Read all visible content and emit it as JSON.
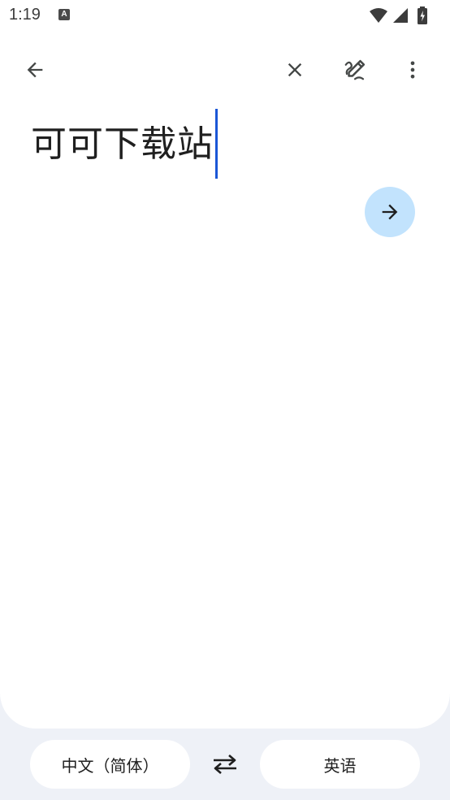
{
  "status_bar": {
    "time": "1:19",
    "notification_icon": "a-letter-icon",
    "icons": [
      "wifi-icon",
      "cellular-signal-icon",
      "battery-charging-icon"
    ]
  },
  "toolbar": {
    "back_icon": "arrow-left-icon",
    "clear_icon": "close-icon",
    "handwriting_icon": "handwriting-pen-icon",
    "more_icon": "more-vertical-icon"
  },
  "input": {
    "text": "可可下载站"
  },
  "translate_button": {
    "icon": "arrow-right-icon",
    "bg_color": "#c2e3fd"
  },
  "languages": {
    "source": "中文（简体）",
    "target": "英语",
    "swap_icon": "swap-arrows-icon"
  },
  "colors": {
    "caret": "#1a56d6",
    "page_background": "#eef1f7",
    "card": "#ffffff"
  }
}
